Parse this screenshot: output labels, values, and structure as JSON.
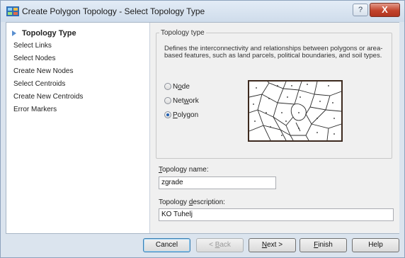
{
  "window": {
    "title": "Create Polygon Topology - Select Topology Type",
    "help_glyph": "?",
    "close_glyph": "X"
  },
  "nav": {
    "items": [
      {
        "label": "Topology Type",
        "active": true
      },
      {
        "label": "Select Links"
      },
      {
        "label": "Select Nodes"
      },
      {
        "label": "Create New Nodes"
      },
      {
        "label": "Select Centroids"
      },
      {
        "label": "Create New Centroids"
      },
      {
        "label": "Error Markers"
      }
    ]
  },
  "topology_group": {
    "label": "Topology type",
    "description": "Defines the interconnectivity and relationships between polygons or area-based features, such as land parcels, political boundaries, and soil types.",
    "options": [
      {
        "pre": "N",
        "mnemonic": "o",
        "post": "de",
        "selected": false
      },
      {
        "pre": "Net",
        "mnemonic": "w",
        "post": "ork",
        "selected": false
      },
      {
        "pre": "",
        "mnemonic": "P",
        "post": "olygon",
        "selected": true
      }
    ]
  },
  "name_field": {
    "label_mnemonic": "T",
    "label_rest": "opology name:",
    "value": "zgrade"
  },
  "description_field": {
    "label_pre": "Topology ",
    "label_mnemonic": "d",
    "label_rest": "escription:",
    "value": "KO Tuhelj"
  },
  "buttons": {
    "cancel": "Cancel",
    "back_pre": "< ",
    "back_mnemonic": "B",
    "back_rest": "ack",
    "next_mnemonic": "N",
    "next_rest": "ext >",
    "finish_mnemonic": "F",
    "finish_rest": "inish",
    "help": "Help"
  },
  "colors": {
    "preview_border": "#3d2a1f",
    "close_button": "#c2442c",
    "selected_radio": "#1e5fb4"
  }
}
